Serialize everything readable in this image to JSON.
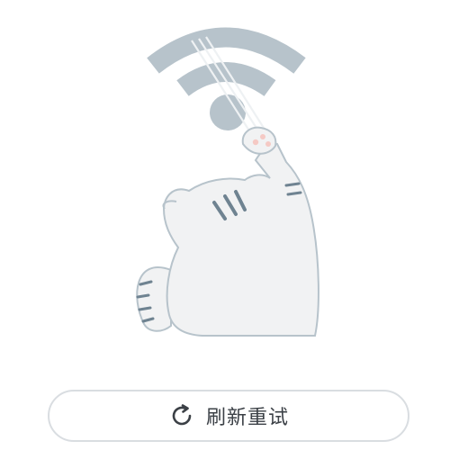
{
  "illustration": {
    "name": "cat-pulling-wifi-signal",
    "colors": {
      "wifi": "#b7c3cb",
      "cat_fill": "#f1f2f3",
      "cat_outline": "#b7c3cb",
      "stripes": "#6f8391",
      "paw_pad": "#f5c9c4"
    }
  },
  "retry_button": {
    "label": "刷新重试",
    "icon": "refresh-icon",
    "border_color": "#d9dde1",
    "text_color": "#3b4046"
  }
}
